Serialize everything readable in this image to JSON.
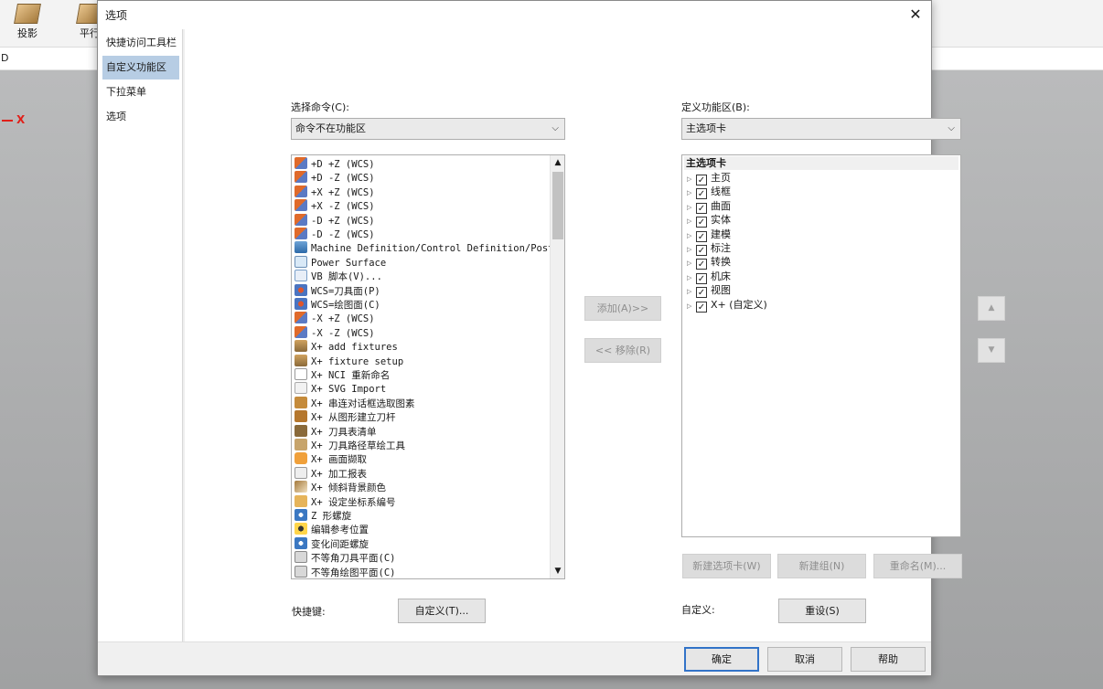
{
  "background_app": {
    "ribbon": [
      {
        "label": "投影",
        "icon": "projection-icon"
      },
      {
        "label": "平行",
        "icon": "parallel-icon"
      }
    ],
    "bar2_text": "D",
    "axis_label": "X"
  },
  "dialog": {
    "title": "选项",
    "close_label": "✕",
    "nav": {
      "items": [
        {
          "label": "快捷访问工具栏",
          "selected": false
        },
        {
          "label": "自定义功能区",
          "selected": true
        },
        {
          "label": "下拉菜单",
          "selected": false
        },
        {
          "label": "选项",
          "selected": false
        }
      ]
    },
    "left": {
      "label": "选择命令(C):",
      "combo_value": "命令不在功能区",
      "commands": [
        {
          "icon": "axis-icon",
          "label": "+D +Z (WCS)"
        },
        {
          "icon": "axis-icon",
          "label": "+D -Z (WCS)"
        },
        {
          "icon": "axis-icon",
          "label": "+X +Z (WCS)"
        },
        {
          "icon": "axis-icon",
          "label": "+X -Z (WCS)"
        },
        {
          "icon": "axis-icon",
          "label": "-D +Z (WCS)"
        },
        {
          "icon": "axis-icon",
          "label": "-D -Z (WCS)"
        },
        {
          "icon": "machine-definition-icon",
          "label": "Machine Definition/Control Definition/Post Re"
        },
        {
          "icon": "power-surface-icon",
          "label": "Power Surface"
        },
        {
          "icon": "vb-script-icon",
          "label": "VB 脚本(V)..."
        },
        {
          "icon": "wcs-icon",
          "label": "WCS=刀具面(P)"
        },
        {
          "icon": "wcs-icon",
          "label": "WCS=绘图面(C)"
        },
        {
          "icon": "axis-icon",
          "label": "-X +Z (WCS)"
        },
        {
          "icon": "axis-icon",
          "label": "-X -Z (WCS)"
        },
        {
          "icon": "fixture-icon",
          "label": "X+ add fixtures"
        },
        {
          "icon": "fixture-icon",
          "label": "X+ fixture setup"
        },
        {
          "icon": "nci-rename-icon",
          "label": "X+ NCI 重新命名"
        },
        {
          "icon": "svg-icon",
          "label": "X+ SVG Import"
        },
        {
          "icon": "chain-icon",
          "label": "X+ 串连对话框选取图素"
        },
        {
          "icon": "tool-icon",
          "label": "X+ 从图形建立刀杆"
        },
        {
          "icon": "tool-list-icon",
          "label": "X+ 刀具表清单"
        },
        {
          "icon": "sketch-icon",
          "label": "X+ 刀具路径草绘工具"
        },
        {
          "icon": "camera-icon",
          "label": "X+ 画面撷取"
        },
        {
          "icon": "report-icon",
          "label": "X+ 加工报表"
        },
        {
          "icon": "gradient-icon",
          "label": "X+ 倾斜背景颜色"
        },
        {
          "icon": "coordinate-icon",
          "label": "X+ 设定坐标系编号"
        },
        {
          "icon": "spiral-icon",
          "label": "Z 形螺旋"
        },
        {
          "icon": "reference-icon",
          "label": "编辑参考位置"
        },
        {
          "icon": "spiral-icon",
          "label": "变化间距螺旋"
        },
        {
          "icon": "plane-icon",
          "label": "不等角刀具平面(C)"
        },
        {
          "icon": "plane-icon",
          "label": "不等角绘图平面(C)"
        }
      ],
      "shortcut_label": "快捷键:",
      "customize_button": "自定义(T)..."
    },
    "middle": {
      "add_button": "添加(A)>>",
      "remove_button": "<< 移除(R)"
    },
    "right": {
      "label": "定义功能区(B):",
      "combo_value": "主选项卡",
      "tree_root": "主选项卡",
      "tree": [
        {
          "label": "主页",
          "checked": true
        },
        {
          "label": "线框",
          "checked": true
        },
        {
          "label": "曲面",
          "checked": true
        },
        {
          "label": "实体",
          "checked": true
        },
        {
          "label": "建模",
          "checked": true
        },
        {
          "label": "标注",
          "checked": true
        },
        {
          "label": "转换",
          "checked": true
        },
        {
          "label": "机床",
          "checked": true
        },
        {
          "label": "视图",
          "checked": true
        },
        {
          "label": "X+ (自定义)",
          "checked": true
        }
      ],
      "move_up_icon": "▲",
      "move_down_icon": "▼",
      "new_tab_button": "新建选项卡(W)",
      "new_group_button": "新建组(N)",
      "rename_button": "重命名(M)...",
      "custom_label": "自定义:",
      "reset_button": "重设(S)"
    },
    "footer": {
      "ok": "确定",
      "cancel": "取消",
      "help": "帮助"
    }
  }
}
